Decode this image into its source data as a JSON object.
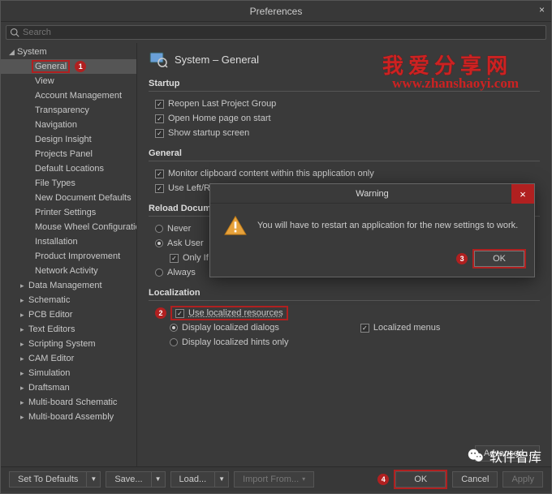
{
  "window": {
    "title": "Preferences"
  },
  "search": {
    "placeholder": "Search"
  },
  "tree": {
    "system": "System",
    "system_children": [
      "General",
      "View",
      "Account Management",
      "Transparency",
      "Navigation",
      "Design Insight",
      "Projects Panel",
      "Default Locations",
      "File Types",
      "New Document Defaults",
      "Printer Settings",
      "Mouse Wheel Configuration",
      "Installation",
      "Product Improvement",
      "Network Activity"
    ],
    "others": [
      "Data Management",
      "Schematic",
      "PCB Editor",
      "Text Editors",
      "Scripting System",
      "CAM Editor",
      "Simulation",
      "Draftsman",
      "Multi-board Schematic",
      "Multi-board Assembly"
    ]
  },
  "page": {
    "title": "System – General"
  },
  "startup": {
    "heading": "Startup",
    "reopen": "Reopen Last Project Group",
    "openhome": "Open Home page on start",
    "showsplash": "Show startup screen"
  },
  "general": {
    "heading": "General",
    "monitor": "Monitor clipboard content within this application only",
    "leftright": "Use Left/Right selection"
  },
  "reload": {
    "heading": "Reload Docum",
    "never": "Never",
    "ask": "Ask User",
    "onlyif": "Only If",
    "always": "Always"
  },
  "localization": {
    "heading": "Localization",
    "use": "Use localized resources",
    "dialogs": "Display localized dialogs",
    "menus": "Localized menus",
    "hints": "Display localized hints only"
  },
  "advanced": "Advanced...",
  "footer": {
    "defaults": "Set To Defaults",
    "save": "Save...",
    "load": "Load...",
    "import": "Import From...",
    "ok": "OK",
    "cancel": "Cancel",
    "apply": "Apply"
  },
  "dialog": {
    "title": "Warning",
    "message": "You will have to restart an application for the new settings to work.",
    "ok": "OK"
  },
  "badges": {
    "b1": "1",
    "b2": "2",
    "b3": "3",
    "b4": "4"
  },
  "watermark": {
    "cn": "我爱分享网",
    "url": "www.zhanshaoyi.com",
    "brand": "软件智库"
  }
}
